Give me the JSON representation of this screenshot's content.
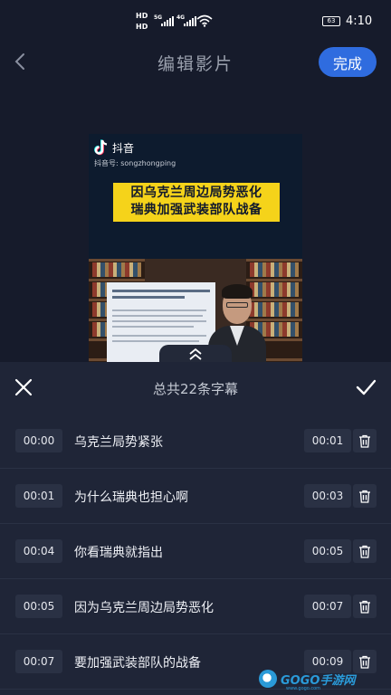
{
  "status_bar": {
    "hd_top": "HD",
    "hd_bottom": "HD",
    "net_a": "5G",
    "net_b": "4G",
    "battery": "63",
    "time": "4:10"
  },
  "header": {
    "title": "编辑影片",
    "done_label": "完成"
  },
  "video": {
    "platform_name": "抖音",
    "account_id": "抖音号: songzhongping",
    "caption_lines": [
      "因乌克兰周边局势恶化",
      "瑞典加强武装部队战备"
    ]
  },
  "panel": {
    "title": "总共22条字幕",
    "subtitles": [
      {
        "start": "00:00",
        "text": "乌克兰局势紧张",
        "end": "00:01"
      },
      {
        "start": "00:01",
        "text": "为什么瑞典也担心啊",
        "end": "00:03"
      },
      {
        "start": "00:04",
        "text": "你看瑞典就指出",
        "end": "00:05"
      },
      {
        "start": "00:05",
        "text": "因为乌克兰周边局势恶化",
        "end": "00:07"
      },
      {
        "start": "00:07",
        "text": "要加强武装部队的战备",
        "end": "00:09"
      }
    ]
  },
  "watermark": {
    "text": "GOGO手游网",
    "sub": "www.gogo.com"
  },
  "colors": {
    "background": "#161b2b",
    "panel": "#1f2537",
    "accent": "#2f6cdf",
    "caption_bg": "#f5d31a"
  }
}
